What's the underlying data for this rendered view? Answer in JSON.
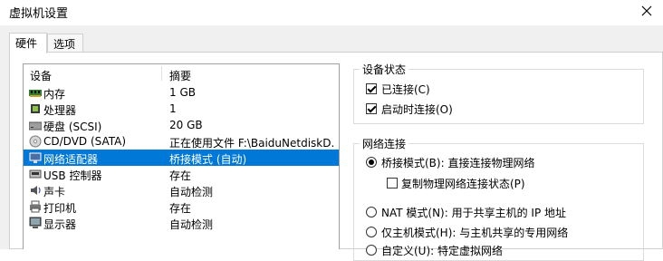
{
  "window": {
    "title": "虚拟机设置"
  },
  "tabs": [
    {
      "label": "硬件",
      "selected": true
    },
    {
      "label": "选项",
      "selected": false
    }
  ],
  "device_list": {
    "headers": {
      "device": "设备",
      "summary": "摘要"
    },
    "rows": [
      {
        "icon": "memory-icon",
        "name": "内存",
        "summary": "1 GB",
        "selected": false
      },
      {
        "icon": "processor-icon",
        "name": "处理器",
        "summary": "1",
        "selected": false
      },
      {
        "icon": "hard-disk-icon",
        "name": "硬盘 (SCSI)",
        "summary": "20 GB",
        "selected": false
      },
      {
        "icon": "cd-dvd-icon",
        "name": "CD/DVD (SATA)",
        "summary": "正在使用文件 F:\\BaiduNetdiskD...",
        "selected": false
      },
      {
        "icon": "network-adapter-icon",
        "name": "网络适配器",
        "summary": "桥接模式 (自动)",
        "selected": true
      },
      {
        "icon": "usb-icon",
        "name": "USB 控制器",
        "summary": "存在",
        "selected": false
      },
      {
        "icon": "sound-card-icon",
        "name": "声卡",
        "summary": "自动检测",
        "selected": false
      },
      {
        "icon": "printer-icon",
        "name": "打印机",
        "summary": "存在",
        "selected": false
      },
      {
        "icon": "display-icon",
        "name": "显示器",
        "summary": "自动检测",
        "selected": false
      }
    ]
  },
  "device_status": {
    "title": "设备状态",
    "connected": {
      "label": "已连接(C)",
      "checked": true
    },
    "connect_at_power_on": {
      "label": "启动时连接(O)",
      "checked": true
    }
  },
  "network_connection": {
    "title": "网络连接",
    "bridged": {
      "label": "桥接模式(B): 直接连接物理网络",
      "selected": true
    },
    "replicate_state": {
      "label": "复制物理网络连接状态(P)",
      "checked": false
    },
    "nat": {
      "label": "NAT 模式(N): 用于共享主机的 IP 地址",
      "selected": false
    },
    "host_only": {
      "label": "仅主机模式(H): 与主机共享的专用网络",
      "selected": false
    },
    "custom_partial": "自定义(U): 特定虚拟网络"
  },
  "colors": {
    "selection": "#0078d7",
    "background": "#f0f0f0"
  }
}
